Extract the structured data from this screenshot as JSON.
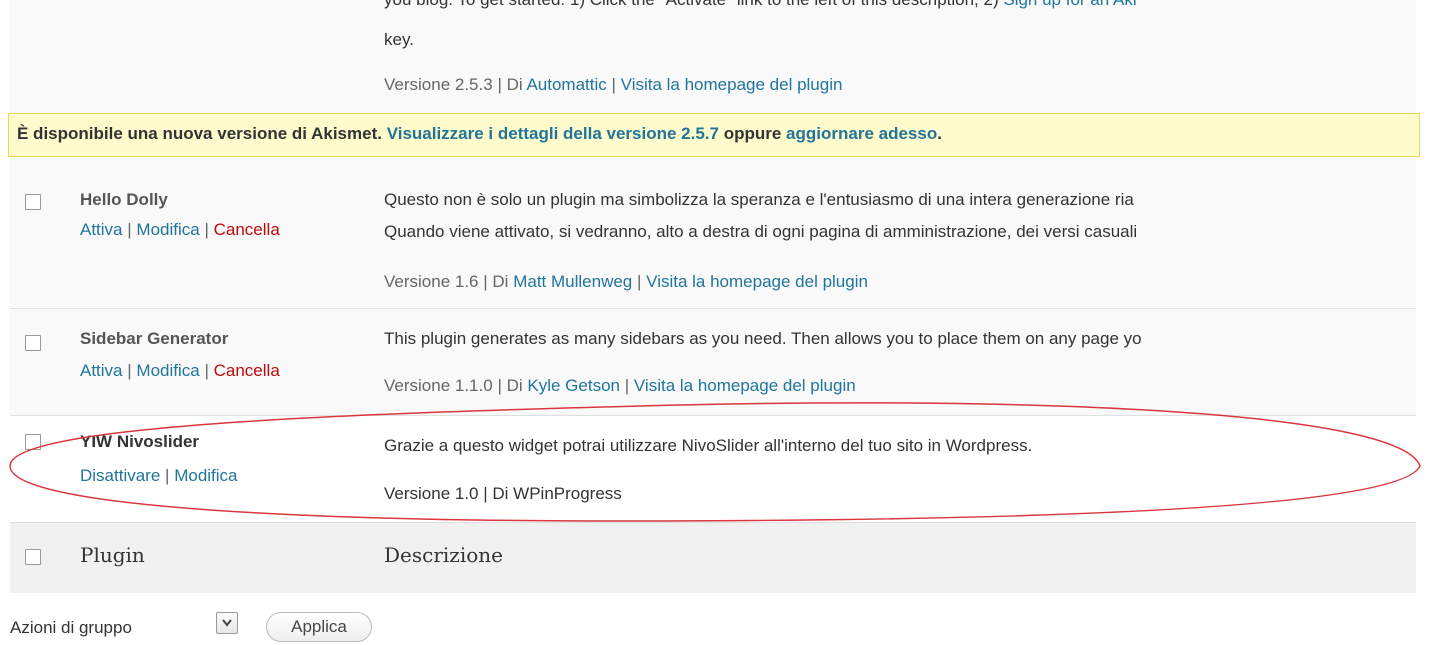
{
  "akismet": {
    "desc_partial": "you blog. To get started: 1) Click the \"Activate\" link to the left of this description, 2)",
    "desc_link_partial": "Sign up for an Aki",
    "desc_line2": "key.",
    "meta": {
      "version": "Versione 2.5.3",
      "by": "Di",
      "author": "Automattic",
      "homepage": "Visita la homepage del plugin"
    }
  },
  "notice": {
    "prefix": "È disponibile una nuova versione di Akismet.",
    "details_link": "Visualizzare i dettagli della versione 2.5.7",
    "or": "oppure",
    "update_link": "aggiornare adesso",
    "suffix": "."
  },
  "plugins": [
    {
      "name": "Hello Dolly",
      "actions": {
        "activate": "Attiva",
        "edit": "Modifica",
        "delete": "Cancella"
      },
      "desc_line1": "Questo non è solo un plugin ma simbolizza la speranza e l'entusiasmo di una intera generazione ria",
      "desc_line2": "Quando viene attivato, si vedranno, alto a destra di ogni pagina di amministrazione, dei versi casuali",
      "version": "Versione 1.6",
      "by": "Di",
      "author": "Matt Mullenweg",
      "homepage": "Visita la homepage del plugin"
    },
    {
      "name": "Sidebar Generator",
      "actions": {
        "activate": "Attiva",
        "edit": "Modifica",
        "delete": "Cancella"
      },
      "desc_line1": "This plugin generates as many sidebars as you need. Then allows you to place them on any page yo",
      "version": "Versione 1.1.0",
      "by": "Di",
      "author": "Kyle Getson",
      "homepage": "Visita la homepage del plugin"
    },
    {
      "name": "YIW Nivoslider",
      "actions": {
        "deactivate": "Disattivare",
        "edit": "Modifica"
      },
      "desc_line1": "Grazie a questo widget potrai utilizzare NivoSlider all'interno del tuo sito in Wordpress.",
      "meta": "Versione 1.0 | Di WPinProgress"
    }
  ],
  "footer": {
    "col_plugin": "Plugin",
    "col_description": "Descrizione"
  },
  "bulk": {
    "label": "Azioni di gruppo",
    "apply": "Applica"
  },
  "sep": "|",
  "colors": {
    "link": "#21759b",
    "delete": "#bc0b0b",
    "notice_bg": "#fffbcc",
    "annotation": "#d9363e"
  }
}
